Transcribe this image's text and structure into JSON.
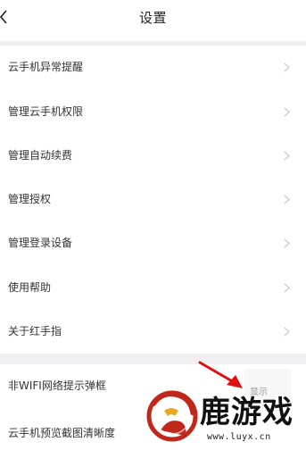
{
  "header": {
    "title": "设置"
  },
  "menu": {
    "items": [
      {
        "label": "云手机异常提醒"
      },
      {
        "label": "管理云手机权限"
      },
      {
        "label": "管理自动续费"
      },
      {
        "label": "管理授权"
      },
      {
        "label": "管理登录设备"
      },
      {
        "label": "使用帮助"
      },
      {
        "label": "关于红手指"
      }
    ]
  },
  "settings": {
    "items": [
      {
        "label": "非WIFI网络提示弹框",
        "value": "显示"
      },
      {
        "label": "云手机预览截图清晰度"
      }
    ]
  },
  "watermark": {
    "title": "鹿游戏",
    "url": "www.luyx.cn"
  },
  "colors": {
    "page_bg": "#f0f0f2",
    "card_bg": "#ffffff",
    "annotation_arrow": "#e01010",
    "logo_red": "#c0281c"
  }
}
